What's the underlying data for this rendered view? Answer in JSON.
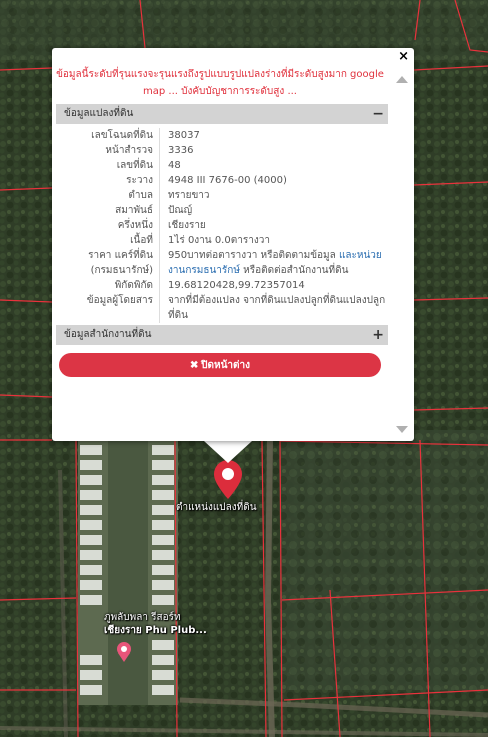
{
  "popup": {
    "close_symbol": "×",
    "warning_text": "ข้อมูลนี้ระดับที่รุนแรงจะรุนแรงถึงรูปแบบรูปแปลงร่างที่มีระดับสูงมาก google map ... บังคับบัญชาการระดับสูง ...",
    "section_parcel": {
      "title": "ข้อมูลแปลงที่ดิน",
      "toggle": "−"
    },
    "rows": [
      {
        "label": "เลขโฉนดที่ดิน",
        "value": "38037"
      },
      {
        "label": "หน้าสำรวจ",
        "value": "3336"
      },
      {
        "label": "เลขที่ดิน",
        "value": "48"
      },
      {
        "label": "ระวาง",
        "value": "4948 III 7676-00 (4000)"
      },
      {
        "label": "ตำบล",
        "value": "ทรายขาว"
      },
      {
        "label": "สมาพันธ์",
        "value": "ปัณญ์"
      },
      {
        "label": "ครึ่งหนึ่ง",
        "value": "เชียงราย"
      },
      {
        "label": "เนื้อที่",
        "value": "1ไร่ 0งาน 0.0ตารางวา"
      }
    ],
    "price_row": {
      "label_line1": "ราคา แคร์ที่ดิน",
      "label_line2": "(กรมธนารักษ์)",
      "value_plain1": "950บาทต่อตารางวา หรือติดตามข้อมูล ",
      "value_link1": "และหน่วยงานกรมธนารักษ์",
      "value_plain2": " หรือติดต่อสำนักงานที่ดิน"
    },
    "coord_row": {
      "label": "พิกัดพิกัด",
      "value": "19.68120428,99.72357014"
    },
    "owner_row": {
      "label": "ข้อมูลผู้โดยสาร",
      "value": "จากที่มีต้องแปลง จากที่ดินแปลงปลูกที่ดินแปลงปลูกที่ดิน"
    },
    "section_office": {
      "title": "ข้อมูลสำนักงานที่ดิน",
      "toggle": "+"
    },
    "close_button": {
      "icon": "✖",
      "label": "ปิดหน้าต่าง"
    }
  },
  "map": {
    "pin_label": "ตำแหน่งแปลงที่ดิน",
    "place_line1": "ภูพลับพลา รีสอร์ท",
    "place_line2": "เชียงราย Phu Plub..."
  },
  "colors": {
    "pin": "#dc2d3c",
    "parcel_line": "#e8323c",
    "button": "#dc3545",
    "warning": "#e0303c",
    "link": "#2a6db0"
  }
}
